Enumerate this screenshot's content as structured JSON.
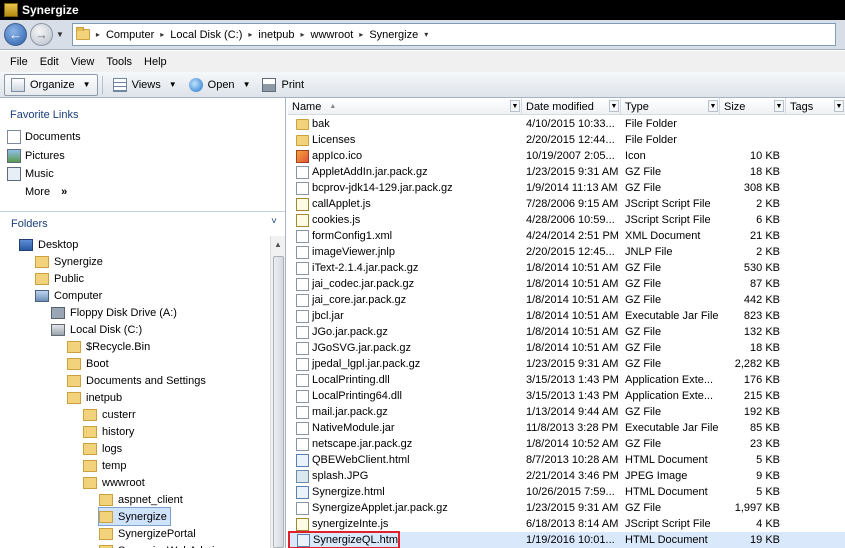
{
  "window": {
    "title": "Synergize"
  },
  "address": {
    "crumbs": [
      "Computer",
      "Local Disk (C:)",
      "inetpub",
      "wwwroot",
      "Synergize"
    ]
  },
  "menu": [
    "File",
    "Edit",
    "View",
    "Tools",
    "Help"
  ],
  "toolbar": {
    "organize": "Organize",
    "views": "Views",
    "open": "Open",
    "print": "Print"
  },
  "favorites": {
    "title": "Favorite Links",
    "links": [
      "Documents",
      "Pictures",
      "Music"
    ],
    "more": "More",
    "more_arrow": "»"
  },
  "folders": {
    "title": "Folders",
    "collapse_glyph": "˅",
    "tree": [
      {
        "label": "Desktop",
        "indent": 1,
        "icon": "desktop-icon"
      },
      {
        "label": "Synergize",
        "indent": 2,
        "icon": "user-folder-icon"
      },
      {
        "label": "Public",
        "indent": 2,
        "icon": "folder-icon"
      },
      {
        "label": "Computer",
        "indent": 2,
        "icon": "computer-icon"
      },
      {
        "label": "Floppy Disk Drive (A:)",
        "indent": 3,
        "icon": "floppy-icon"
      },
      {
        "label": "Local Disk (C:)",
        "indent": 3,
        "icon": "drive-icon"
      },
      {
        "label": "$Recycle.Bin",
        "indent": 4,
        "icon": "folder-icon"
      },
      {
        "label": "Boot",
        "indent": 4,
        "icon": "folder-icon"
      },
      {
        "label": "Documents and Settings",
        "indent": 4,
        "icon": "shortcut-folder-icon"
      },
      {
        "label": "inetpub",
        "indent": 4,
        "icon": "folder-icon"
      },
      {
        "label": "custerr",
        "indent": 5,
        "icon": "folder-icon"
      },
      {
        "label": "history",
        "indent": 5,
        "icon": "folder-icon"
      },
      {
        "label": "logs",
        "indent": 5,
        "icon": "folder-icon"
      },
      {
        "label": "temp",
        "indent": 5,
        "icon": "folder-icon"
      },
      {
        "label": "wwwroot",
        "indent": 5,
        "icon": "folder-icon"
      },
      {
        "label": "aspnet_client",
        "indent": 6,
        "icon": "folder-icon"
      },
      {
        "label": "Synergize",
        "indent": 6,
        "icon": "folder-icon",
        "selected": true
      },
      {
        "label": "SynergizePortal",
        "indent": 6,
        "icon": "folder-icon"
      },
      {
        "label": "SynergizeWebAdmin",
        "indent": 6,
        "icon": "folder-icon"
      }
    ]
  },
  "columns": {
    "name": "Name",
    "date": "Date modified",
    "type": "Type",
    "size": "Size",
    "tags": "Tags"
  },
  "files": [
    {
      "name": "bak",
      "date": "4/10/2015 10:33...",
      "type": "File Folder",
      "size": "",
      "icon": "folder"
    },
    {
      "name": "Licenses",
      "date": "2/20/2015 12:44...",
      "type": "File Folder",
      "size": "",
      "icon": "folder"
    },
    {
      "name": "appIco.ico",
      "date": "10/19/2007 2:05...",
      "type": "Icon",
      "size": "10 KB",
      "icon": "ico"
    },
    {
      "name": "AppletAddIn.jar.pack.gz",
      "date": "1/23/2015 9:31 AM",
      "type": "GZ File",
      "size": "18 KB",
      "icon": "file"
    },
    {
      "name": "bcprov-jdk14-129.jar.pack.gz",
      "date": "1/9/2014 11:13 AM",
      "type": "GZ File",
      "size": "308 KB",
      "icon": "file"
    },
    {
      "name": "callApplet.js",
      "date": "7/28/2006 9:15 AM",
      "type": "JScript Script File",
      "size": "2 KB",
      "icon": "js"
    },
    {
      "name": "cookies.js",
      "date": "4/28/2006 10:59...",
      "type": "JScript Script File",
      "size": "6 KB",
      "icon": "js"
    },
    {
      "name": "formConfig1.xml",
      "date": "4/24/2014 2:51 PM",
      "type": "XML Document",
      "size": "21 KB",
      "icon": "file"
    },
    {
      "name": "imageViewer.jnlp",
      "date": "2/20/2015 12:45...",
      "type": "JNLP File",
      "size": "2 KB",
      "icon": "file"
    },
    {
      "name": "iText-2.1.4.jar.pack.gz",
      "date": "1/8/2014 10:51 AM",
      "type": "GZ File",
      "size": "530 KB",
      "icon": "file"
    },
    {
      "name": "jai_codec.jar.pack.gz",
      "date": "1/8/2014 10:51 AM",
      "type": "GZ File",
      "size": "87 KB",
      "icon": "file"
    },
    {
      "name": "jai_core.jar.pack.gz",
      "date": "1/8/2014 10:51 AM",
      "type": "GZ File",
      "size": "442 KB",
      "icon": "file"
    },
    {
      "name": "jbcl.jar",
      "date": "1/8/2014 10:51 AM",
      "type": "Executable Jar File",
      "size": "823 KB",
      "icon": "file"
    },
    {
      "name": "JGo.jar.pack.gz",
      "date": "1/8/2014 10:51 AM",
      "type": "GZ File",
      "size": "132 KB",
      "icon": "file"
    },
    {
      "name": "JGoSVG.jar.pack.gz",
      "date": "1/8/2014 10:51 AM",
      "type": "GZ File",
      "size": "18 KB",
      "icon": "file"
    },
    {
      "name": "jpedal_lgpl.jar.pack.gz",
      "date": "1/23/2015 9:31 AM",
      "type": "GZ File",
      "size": "2,282 KB",
      "icon": "file"
    },
    {
      "name": "LocalPrinting.dll",
      "date": "3/15/2013 1:43 PM",
      "type": "Application Exte...",
      "size": "176 KB",
      "icon": "file"
    },
    {
      "name": "LocalPrinting64.dll",
      "date": "3/15/2013 1:43 PM",
      "type": "Application Exte...",
      "size": "215 KB",
      "icon": "file"
    },
    {
      "name": "mail.jar.pack.gz",
      "date": "1/13/2014 9:44 AM",
      "type": "GZ File",
      "size": "192 KB",
      "icon": "file"
    },
    {
      "name": "NativeModule.jar",
      "date": "11/8/2013 3:28 PM",
      "type": "Executable Jar File",
      "size": "85 KB",
      "icon": "file"
    },
    {
      "name": "netscape.jar.pack.gz",
      "date": "1/8/2014 10:52 AM",
      "type": "GZ File",
      "size": "23 KB",
      "icon": "file"
    },
    {
      "name": "QBEWebClient.html",
      "date": "8/7/2013 10:28 AM",
      "type": "HTML Document",
      "size": "5 KB",
      "icon": "html"
    },
    {
      "name": "splash.JPG",
      "date": "2/21/2014 3:46 PM",
      "type": "JPEG Image",
      "size": "9 KB",
      "icon": "img"
    },
    {
      "name": "Synergize.html",
      "date": "10/26/2015 7:59...",
      "type": "HTML Document",
      "size": "5 KB",
      "icon": "html"
    },
    {
      "name": "SynergizeApplet.jar.pack.gz",
      "date": "1/23/2015 9:31 AM",
      "type": "GZ File",
      "size": "1,997 KB",
      "icon": "file"
    },
    {
      "name": "synergizeInte.js",
      "date": "6/18/2013 8:14 AM",
      "type": "JScript Script File",
      "size": "4 KB",
      "icon": "js"
    },
    {
      "name": "SynergizeQL.html",
      "date": "1/19/2016 10:01...",
      "type": "HTML Document",
      "size": "19 KB",
      "icon": "html",
      "highlight": true
    }
  ],
  "colors": {
    "highlight_border": "#e0202a",
    "selection": "#cfe3fc"
  }
}
